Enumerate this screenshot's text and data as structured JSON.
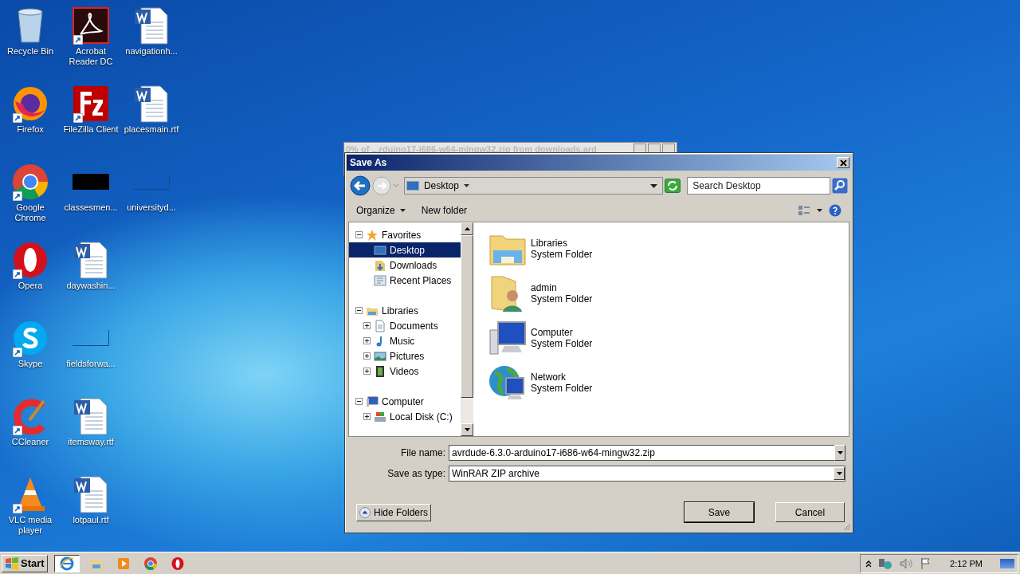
{
  "desktop": {
    "columns": [
      [
        {
          "label": "Recycle Bin",
          "kind": "recycle",
          "shortcut": false
        },
        {
          "label": "Firefox",
          "kind": "firefox",
          "shortcut": true
        },
        {
          "label": "Google Chrome",
          "kind": "chrome",
          "shortcut": true
        },
        {
          "label": "Opera",
          "kind": "opera",
          "shortcut": true
        },
        {
          "label": "Skype",
          "kind": "skype",
          "shortcut": true
        },
        {
          "label": "CCleaner",
          "kind": "ccleaner",
          "shortcut": true
        },
        {
          "label": "VLC media player",
          "kind": "vlc",
          "shortcut": true
        }
      ],
      [
        {
          "label": "Acrobat Reader DC",
          "kind": "acrobat",
          "shortcut": true
        },
        {
          "label": "FileZilla Client",
          "kind": "filezilla",
          "shortcut": true
        },
        {
          "label": "classesmen...",
          "kind": "black",
          "shortcut": false
        },
        {
          "label": "daywashin...",
          "kind": "word",
          "shortcut": false
        },
        {
          "label": "fieldsforwa...",
          "kind": "blank",
          "shortcut": false
        },
        {
          "label": "itemsway.rtf",
          "kind": "word",
          "shortcut": false
        },
        {
          "label": "lotpaul.rtf",
          "kind": "word",
          "shortcut": false
        }
      ],
      [
        {
          "label": "navigationh...",
          "kind": "word",
          "shortcut": false
        },
        {
          "label": "placesmain.rtf",
          "kind": "word",
          "shortcut": false
        },
        {
          "label": "universityd...",
          "kind": "blank",
          "shortcut": false
        }
      ]
    ]
  },
  "background_window": {
    "title": "0% of ...rduino17-i686-w64-mingw32.zip from downloads.ard"
  },
  "dialog": {
    "title": "Save As",
    "address": "Desktop",
    "search": {
      "placeholder": "Search Desktop"
    },
    "toolbar": [
      "Organize",
      "New folder"
    ],
    "tree": [
      {
        "label": "Favorites",
        "kind": "star",
        "expanded": true,
        "selected": false,
        "children": [
          {
            "label": "Desktop",
            "kind": "desktop",
            "selected": true
          },
          {
            "label": "Downloads",
            "kind": "downloads",
            "selected": false
          },
          {
            "label": "Recent Places",
            "kind": "recent",
            "selected": false
          }
        ]
      },
      {
        "label": "Libraries",
        "kind": "libraries",
        "expanded": true,
        "selected": false,
        "children": [
          {
            "label": "Documents",
            "kind": "documents",
            "expanded": false,
            "selected": false
          },
          {
            "label": "Music",
            "kind": "music",
            "expanded": false,
            "selected": false
          },
          {
            "label": "Pictures",
            "kind": "pictures",
            "expanded": false,
            "selected": false
          },
          {
            "label": "Videos",
            "kind": "videos",
            "expanded": false,
            "selected": false
          }
        ]
      },
      {
        "label": "Computer",
        "kind": "computer",
        "expanded": true,
        "selected": false,
        "children": [
          {
            "label": "Local Disk (C:)",
            "kind": "disk",
            "expanded": false,
            "selected": false
          }
        ]
      }
    ],
    "items": [
      {
        "name": "Libraries",
        "type": "System Folder",
        "kind": "libraries"
      },
      {
        "name": "admin",
        "type": "System Folder",
        "kind": "user"
      },
      {
        "name": "Computer",
        "type": "System Folder",
        "kind": "computer"
      },
      {
        "name": "Network",
        "type": "System Folder",
        "kind": "network"
      }
    ],
    "file_name": {
      "label": "File name:",
      "value": "avrdude-6.3.0-arduino17-i686-w64-mingw32.zip"
    },
    "save_as_type": {
      "label": "Save as type:",
      "value": "WinRAR ZIP archive"
    },
    "hide_folders": "Hide Folders",
    "buttons": [
      "Save",
      "Cancel"
    ]
  },
  "taskbar": {
    "start": "Start",
    "apps": [
      {
        "kind": "ie",
        "selected": true
      },
      {
        "kind": "explorer",
        "selected": false
      },
      {
        "kind": "media",
        "selected": false
      },
      {
        "kind": "chrome",
        "selected": false
      },
      {
        "kind": "opera",
        "selected": false
      }
    ],
    "clock": "2:12 PM"
  }
}
